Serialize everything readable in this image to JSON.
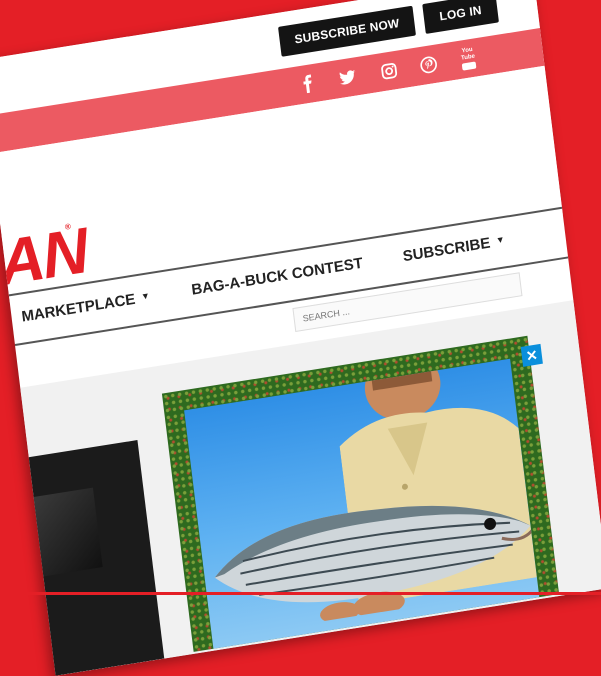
{
  "header": {
    "subscribe_now_label": "SUBSCRIBE NOW",
    "login_label": "LOG IN"
  },
  "social": {
    "icons": [
      "facebook-icon",
      "twitter-icon",
      "instagram-icon",
      "pinterest-icon",
      "youtube-icon"
    ],
    "youtube_text": "You Tube"
  },
  "logo": {
    "text": "AN",
    "registered": "®"
  },
  "nav": {
    "marketplace": "MARKETPLACE",
    "bag_a_buck": "BAG-A-BUCK CONTEST",
    "subscribe": "SUBSCRIBE",
    "caret": "▼"
  },
  "search": {
    "placeholder": "SEARCH ..."
  },
  "ad": {
    "close_label": "✕"
  },
  "colors": {
    "brand_red": "#e41f26",
    "social_bar": "#ec5a62",
    "button_dark": "#141414",
    "ad_close_blue": "#0a8fdc"
  }
}
